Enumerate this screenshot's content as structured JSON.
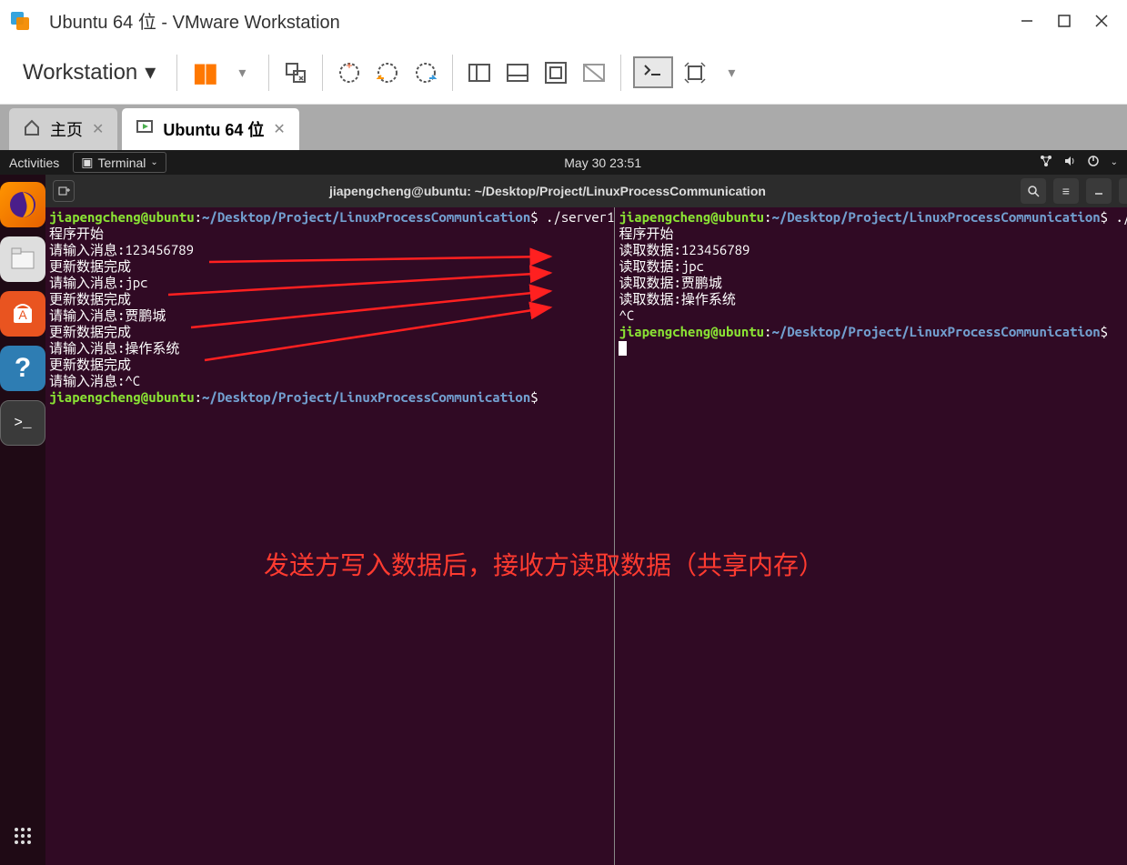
{
  "vmware": {
    "title": "Ubuntu 64 位 - VMware Workstation",
    "workstation_menu": "Workstation",
    "tabs": {
      "home": "主页",
      "active": "Ubuntu 64 位"
    }
  },
  "ubuntu_topbar": {
    "activities": "Activities",
    "terminal_menu": "Terminal",
    "datetime": "May 30  23:51"
  },
  "terminal": {
    "title": "jiapengcheng@ubuntu: ~/Desktop/Project/LinuxProcessCommunication",
    "prompt": {
      "user_host": "jiapengcheng@ubuntu",
      "path": "~/Desktop/Project/LinuxProcessCommunication",
      "symbol": "$"
    },
    "left_pane": {
      "command": " ./server1",
      "lines": [
        "程序开始",
        "请输入消息:123456789",
        "更新数据完成",
        "请输入消息:jpc",
        "更新数据完成",
        "请输入消息:贾鹏城",
        "更新数据完成",
        "请输入消息:操作系统",
        "更新数据完成",
        "请输入消息:^C"
      ]
    },
    "right_pane": {
      "command": " ./client",
      "lines": [
        "程序开始",
        "读取数据:123456789",
        "读取数据:jpc",
        "读取数据:贾鹏城",
        "读取数据:操作系统",
        "^C"
      ]
    }
  },
  "annotation": "发送方写入数据后，接收方读取数据（共享内存）"
}
